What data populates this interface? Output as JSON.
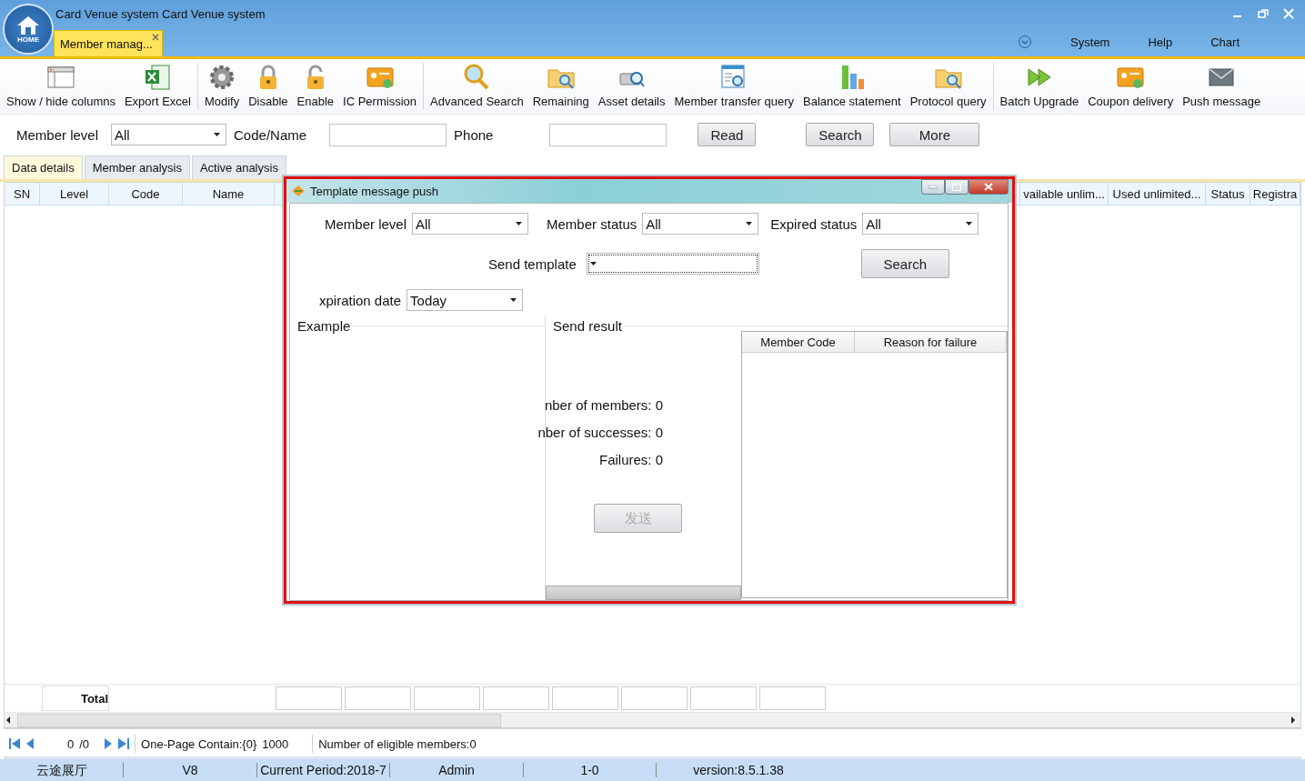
{
  "window": {
    "title": "Card Venue system Card Venue system",
    "logo_label": "HOME"
  },
  "doc_tabs": [
    {
      "label": "Member manag...",
      "selected": true
    }
  ],
  "menu": [
    "System",
    "Help",
    "Chart"
  ],
  "toolbar": [
    [
      {
        "label": "Show / hide columns",
        "kind": "window"
      },
      {
        "label": "Export Excel",
        "kind": "excel"
      }
    ],
    [
      {
        "label": "Modify",
        "kind": "gear"
      },
      {
        "label": "Disable",
        "kind": "lock"
      },
      {
        "label": "Enable",
        "kind": "unlock"
      },
      {
        "label": "IC Permission",
        "kind": "card"
      }
    ],
    [
      {
        "label": "Advanced Search",
        "kind": "search"
      },
      {
        "label": "Remaining",
        "kind": "folder"
      },
      {
        "label": "Asset details",
        "kind": "drive"
      },
      {
        "label": "Member transfer query",
        "kind": "form"
      },
      {
        "label": "Balance statement",
        "kind": "bars"
      },
      {
        "label": "Protocol query",
        "kind": "folder"
      }
    ],
    [
      {
        "label": "Batch Upgrade",
        "kind": "play"
      },
      {
        "label": "Coupon delivery",
        "kind": "card"
      },
      {
        "label": "Push message",
        "kind": "mail"
      }
    ]
  ],
  "filters": {
    "member_level_label": "Member level",
    "member_level": "All",
    "code_name_label": "Code/Name",
    "phone_label": "Phone",
    "buttons": [
      "Read",
      "Search",
      "More"
    ]
  },
  "view_tabs": [
    {
      "label": "Data details",
      "selected": true
    },
    {
      "label": "Member analysis",
      "selected": false
    },
    {
      "label": "Active analysis",
      "selected": false
    }
  ],
  "table": {
    "columns_left": [
      "SN",
      "Level",
      "Code",
      "Name"
    ],
    "columns_right": [
      "vailable unlim...",
      "Used unlimited...",
      "Status",
      "Registra"
    ],
    "total_label": "Total"
  },
  "pager": {
    "page": "0",
    "pages": "/0",
    "per_page_label": "One-Page Contain:{0}",
    "per_page": "1000",
    "count": "Number of eligible members:0"
  },
  "status_bar": [
    "云途展厅",
    "V8",
    "Current Period:2018-7",
    "Admin",
    "1-0",
    "version:8.5.1.38"
  ],
  "dialog": {
    "title": "Template message push",
    "member_level_label": "Member level",
    "member_level": "All",
    "member_status_label": "Member status",
    "member_status": "All",
    "expired_status_label": "Expired status",
    "expired_status": "All",
    "send_template_label": "Send template",
    "search_button": "Search",
    "expiration_label": "xpiration date",
    "expiration": "Today",
    "example_label": "Example",
    "result_label": "Send result",
    "stats": [
      "nber of members: 0",
      "nber of successes: 0",
      "Failures: 0"
    ],
    "send_button": {
      "label": "发送",
      "disabled": true
    },
    "result_columns": [
      "Member Code",
      "Reason for failure"
    ]
  }
}
